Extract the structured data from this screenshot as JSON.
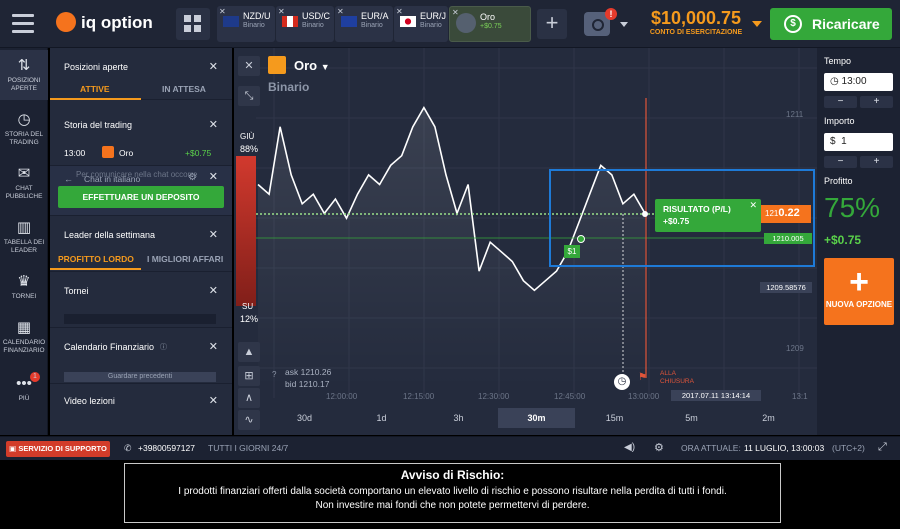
{
  "app": {
    "logo_text": "iq option"
  },
  "tabs": [
    {
      "symbol": "NZD/U",
      "sub": "Binario",
      "flag": "nz"
    },
    {
      "symbol": "USD/C",
      "sub": "Binario",
      "flag": "ca"
    },
    {
      "symbol": "EUR/A",
      "sub": "Binario",
      "flag": "eu"
    },
    {
      "symbol": "EUR/J",
      "sub": "Binario",
      "flag": "jp"
    },
    {
      "symbol": "Oro",
      "sub": "+$0.75",
      "flag": "gold"
    }
  ],
  "header": {
    "alert_count": "!",
    "balance": "$10,000.75",
    "balance_label": "CONTO DI ESERCITAZIONE",
    "recharge_label": "Ricaricare"
  },
  "leftbar": [
    {
      "label": "POSIZIONI APERTE",
      "icon": "arrows-updown-icon"
    },
    {
      "label": "STORIA DEL TRADING",
      "icon": "history-icon"
    },
    {
      "label": "CHAT PUBBLICHE",
      "icon": "chat-icon"
    },
    {
      "label": "TABELLA DEI LEADER",
      "icon": "leaderboard-icon"
    },
    {
      "label": "TORNEI",
      "icon": "trophy-icon"
    },
    {
      "label": "CALENDARIO FINANZIARIO",
      "icon": "calendar-icon"
    },
    {
      "label": "PIÙ",
      "icon": "more-icon",
      "badge": "1"
    }
  ],
  "panel": {
    "open_positions": {
      "title": "Posizioni aperte",
      "tab_active": "ATTIVE",
      "tab_pending": "IN ATTESA"
    },
    "history": {
      "title": "Storia del trading",
      "row_time": "13:00",
      "row_asset": "Oro",
      "row_profit": "+$0.75"
    },
    "chat": {
      "title": "Chat in italiano",
      "placeholder": "Per comunicare nella chat occorre",
      "deposit_button": "EFFETTUARE UN DEPOSITO"
    },
    "leaders": {
      "title": "Leader della settimana",
      "tab1": "PROFITTO LORDO",
      "tab2": "I MIGLIORI AFFARI"
    },
    "tournaments": {
      "title": "Tornei"
    },
    "calendar": {
      "title": "Calendario Finanziario",
      "sub": "Guardare precedenti"
    },
    "video": {
      "title": "Video lezioni"
    }
  },
  "chart": {
    "asset": "Oro",
    "type": "Binario",
    "up_label": "GIÙ",
    "up_pct": "88%",
    "down_label": "SU",
    "down_pct": "12%",
    "ask": "ask 1210.26",
    "bid": "bid 1210.17",
    "price_levels": [
      "1211",
      "1210",
      "1209"
    ],
    "current_price_prefix": "121",
    "current_price": "0.22",
    "open_price": "1210.005",
    "low_price": "1209.58576",
    "result_title": "RISULTATO (P/L)",
    "result_value": "+$0.75",
    "bet_label": "$1",
    "close_label": "ALLA CHIUSURA",
    "expiry_stamp": "2017.07.11 13:14:14",
    "time_labels": [
      "12:00:00",
      "12:15:00",
      "12:30:00",
      "12:45:00",
      "13:00:00",
      "13:1"
    ],
    "timeframes": [
      "30d",
      "1d",
      "3h",
      "30m",
      "15m",
      "5m",
      "2m"
    ],
    "selected_timeframe": "30m",
    "series": [
      1210.7,
      1210.6,
      1211.3,
      1210.8,
      1210.5,
      1210.6,
      1210.4,
      1210.55,
      1210.35,
      1210.6,
      1210.8,
      1210.7,
      1210.9,
      1211.0,
      1211.3,
      1211.5,
      1211.3,
      1210.8,
      1210.4,
      1210.7,
      1209.8,
      1210.1,
      1210.0,
      1209.9,
      1209.7,
      1209.6,
      1209.7,
      1209.8,
      1210.0,
      1210.3,
      1210.6,
      1210.9,
      1210.8,
      1210.5,
      1210.6,
      1210.4
    ],
    "y_range": [
      1209.0,
      1211.6
    ],
    "colors": {
      "up": "#34a83a",
      "down": "#e53b2c",
      "line": "#ffffff",
      "highlight": "#1e7ad7"
    }
  },
  "right": {
    "time_label": "Tempo",
    "time_value": "13:00",
    "amount_label": "Importo",
    "amount_value": "1",
    "amount_currency": "$",
    "profit_label": "Profitto",
    "profit_pct": "75%",
    "profit_value": "+$0.75",
    "new_option": "NUOVA OPZIONE",
    "minus": "−",
    "plus": "+"
  },
  "bottom": {
    "support": "SERVIZIO DI SUPPORTO",
    "phone": "+39800597127",
    "hours": "TUTTI I GIORNI 24/7",
    "time_prefix": "ORA ATTUALE:",
    "time_value": "11 LUGLIO, 13:00:03",
    "tz": "(UTC+2)"
  },
  "risk": {
    "title": "Avviso di Rischio:",
    "line1": "I prodotti finanziari offerti dalla società comportano un elevato livello di rischio e possono risultare nella perdita di tutti i fondi.",
    "line2": "Non investire mai fondi che non potete permettervi di perdere."
  }
}
